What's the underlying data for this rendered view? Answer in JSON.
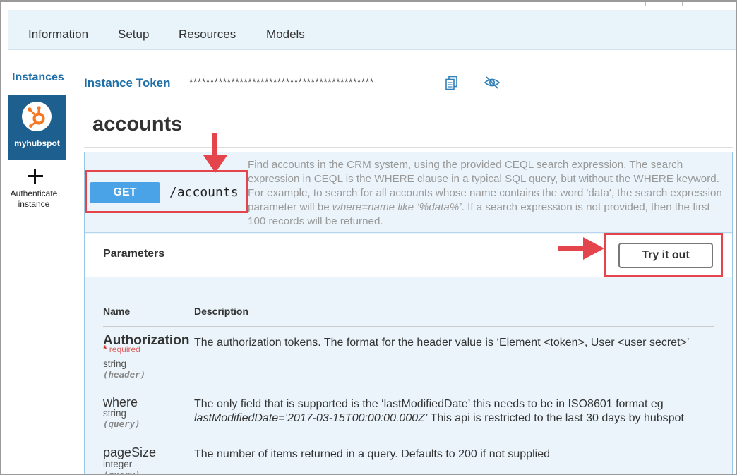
{
  "nav": {
    "tabs": [
      "Information",
      "Setup",
      "Resources",
      "Models"
    ]
  },
  "sidebar": {
    "heading": "Instances",
    "instance": {
      "name": "myhubspot"
    },
    "add": {
      "label": "Authenticate instance"
    }
  },
  "token": {
    "label": "Instance Token",
    "value": "********************************************"
  },
  "resource": {
    "title": "accounts"
  },
  "operation": {
    "method": "GET",
    "path": "/accounts",
    "description_pre": "Find accounts in the CRM system, using the provided CEQL search expression. The search expression in CEQL is the WHERE clause in a typical SQL query, but without the WHERE keyword. For example, to search for all accounts whose name contains the word 'data', the search expression parameter will be ",
    "description_example": "where=name like ‘%data%’",
    "description_post": ". If a search expression is not provided, then the first 100 records will be returned."
  },
  "params": {
    "title": "Parameters",
    "try_label": "Try it out",
    "col_name": "Name",
    "col_desc": "Description",
    "items": [
      {
        "name": "Authorization",
        "required": "required",
        "type": "string",
        "in": "(header)",
        "desc": "The authorization tokens. The format for the header value is ‘Element <token>, User <user secret>’"
      },
      {
        "name": "where",
        "type": "string",
        "in": "(query)",
        "desc_pre": "The only field that is supported is the ‘lastModifiedDate’ this needs to be in ISO8601 format eg ",
        "desc_example": "lastModifiedDate=’2017-03-15T00:00:00.000Z’",
        "desc_post": " This api is restricted to the last 30 days by hubspot"
      },
      {
        "name": "pageSize",
        "type": "integer",
        "in": "(query)",
        "desc": "The number of items returned in a query. Defaults to 200 if not supplied"
      }
    ]
  },
  "colors": {
    "accent": "#1f6fa8",
    "badge": "#49a3e6",
    "annotation": "#e4454c",
    "hubspot": "#f57722"
  }
}
